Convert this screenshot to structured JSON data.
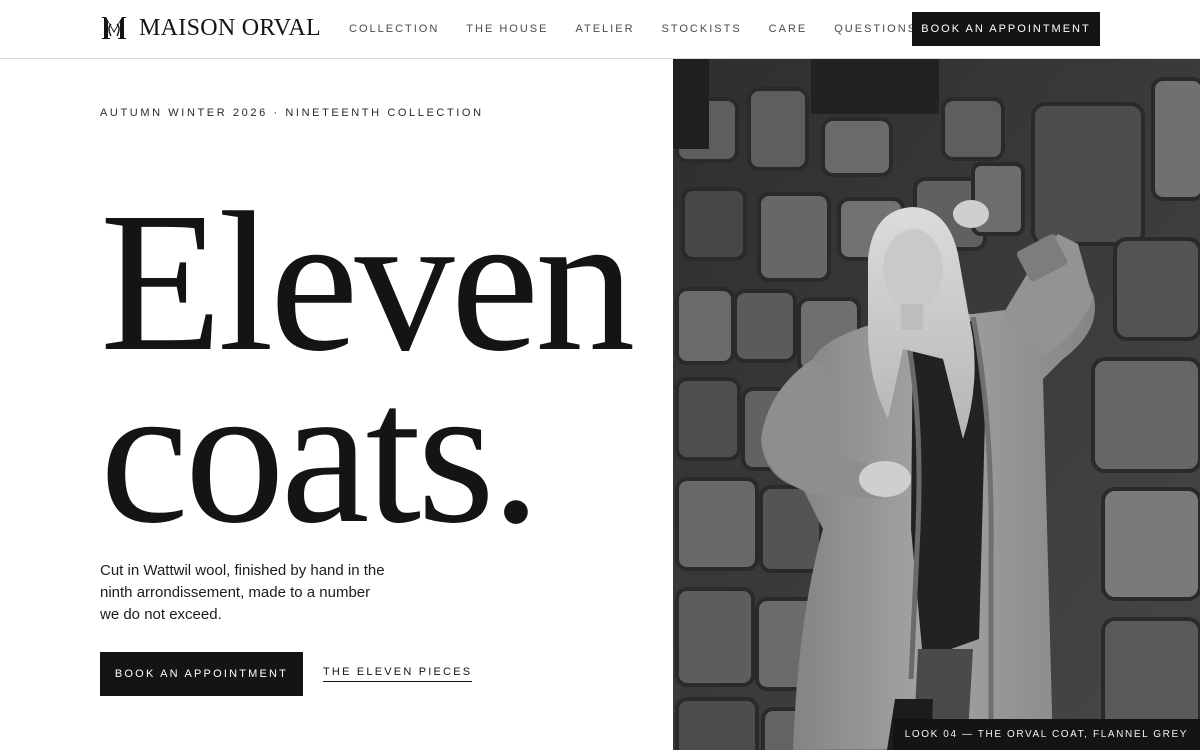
{
  "header": {
    "brand": "MAISON ORVAL",
    "nav": [
      "COLLECTION",
      "THE HOUSE",
      "ATELIER",
      "STOCKISTS",
      "CARE",
      "QUESTIONS"
    ],
    "cta_label": "BOOK AN APPOINTMENT"
  },
  "hero": {
    "eyebrow": "AUTUMN WINTER 2026 · NINETEENTH COLLECTION",
    "headline_line1": "Eleven",
    "headline_line2": "coats.",
    "intro": "Cut in Wattwil wool, finished by hand in the ninth arrondissement, made to a number we do not exceed.",
    "primary_cta": "BOOK AN APPOINTMENT",
    "secondary_link": "THE ELEVEN PIECES"
  },
  "image": {
    "caption": "LOOK 04 — THE ORVAL COAT, FLANNEL GREY"
  },
  "colors": {
    "ink": "#141414",
    "background": "#ffffff",
    "rule": "#d9d9d9"
  }
}
